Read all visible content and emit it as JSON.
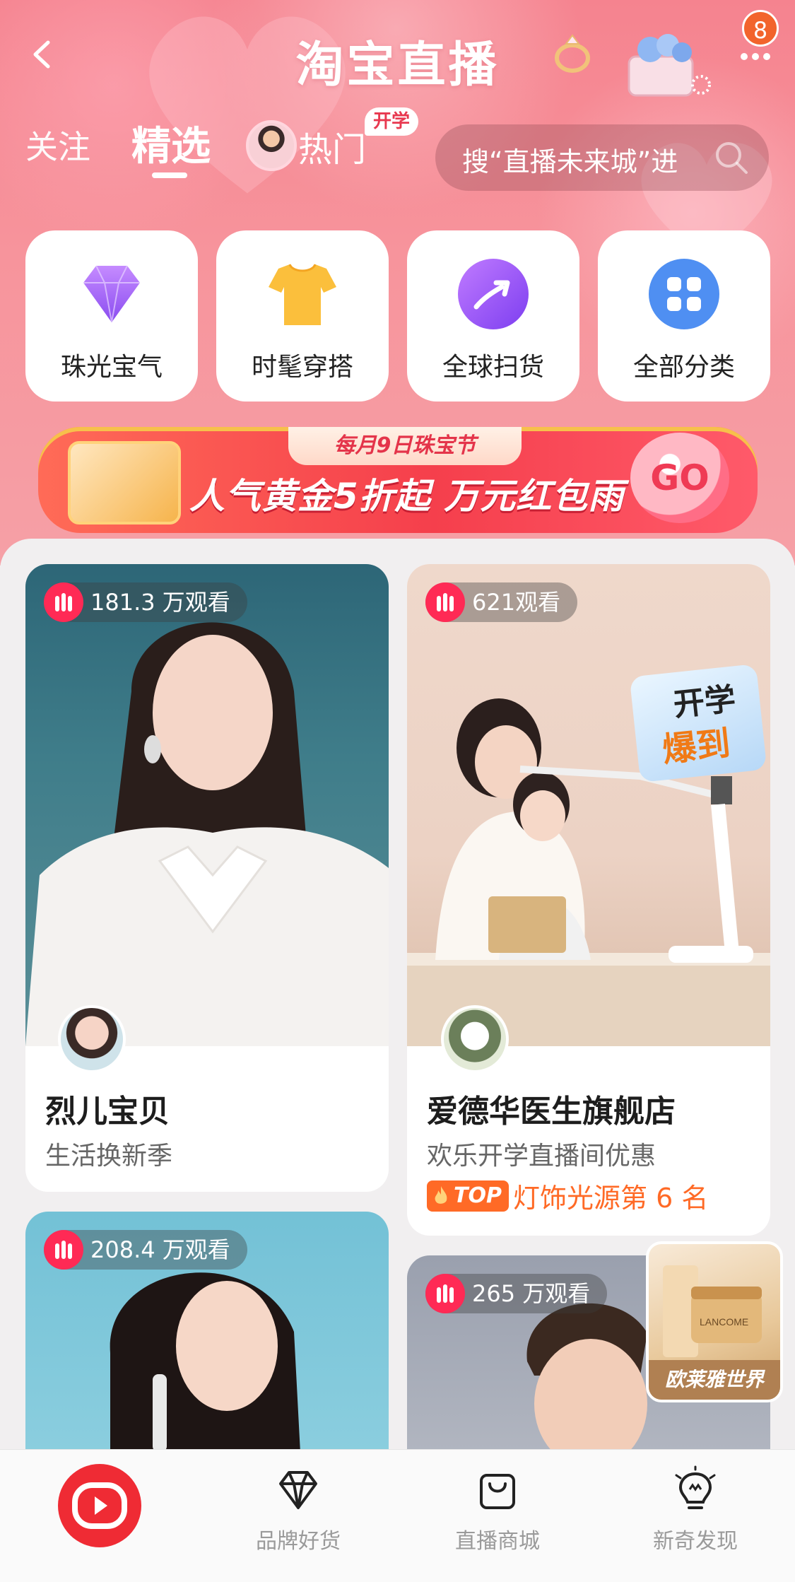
{
  "header": {
    "title": "淘宝直播",
    "notification_count": "8",
    "tabs": [
      {
        "label": "关注"
      },
      {
        "label": "精选"
      },
      {
        "label": "热门",
        "tag": "开学"
      }
    ],
    "search": {
      "placeholder": "搜“直播未来城”进"
    }
  },
  "categories": [
    {
      "label": "珠光宝气",
      "icon": "diamond-icon"
    },
    {
      "label": "时髦穿搭",
      "icon": "tshirt-icon"
    },
    {
      "label": "全球扫货",
      "icon": "trend-arrow-icon"
    },
    {
      "label": "全部分类",
      "icon": "grid-icon"
    }
  ],
  "banner": {
    "tag": "每月9日珠宝节",
    "text": "人气黄金5折起 万元红包雨",
    "button": "GO"
  },
  "feed": [
    {
      "views": "181.3 万观看",
      "name": "烈儿宝贝",
      "subtitle": "生活换新季"
    },
    {
      "views": "621观看",
      "name": "爱德华医生旗舰店",
      "subtitle": "欢乐开学直播间优惠",
      "top_label": "TOP",
      "rank": "灯饰光源第 6 名",
      "overlay_text": [
        "开学",
        "爆到"
      ]
    },
    {
      "views": "208.4 万观看"
    },
    {
      "views": "265 万观看"
    }
  ],
  "floating_ad": {
    "label": "欧莱雅世界",
    "brand": "LANCOME"
  },
  "bottom_nav": [
    {
      "label": "",
      "icon": "live-play-icon"
    },
    {
      "label": "品牌好货",
      "icon": "diamond-outline-icon"
    },
    {
      "label": "直播商城",
      "icon": "shopping-bag-icon"
    },
    {
      "label": "新奇发现",
      "icon": "lightbulb-icon"
    }
  ],
  "colors": {
    "accent": "#ef2b34",
    "header_pink": "#f5838f",
    "rank_orange": "#ff6a26"
  }
}
